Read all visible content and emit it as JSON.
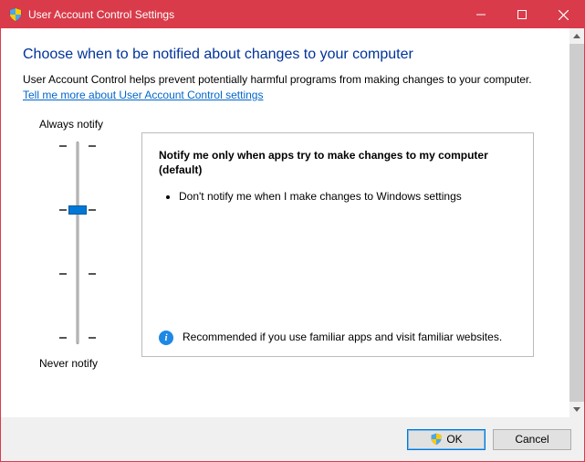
{
  "window": {
    "title": "User Account Control Settings"
  },
  "page": {
    "heading": "Choose when to be notified about changes to your computer",
    "description": "User Account Control helps prevent potentially harmful programs from making changes to your computer.",
    "help_link": "Tell me more about User Account Control settings"
  },
  "slider": {
    "top_label": "Always notify",
    "bottom_label": "Never notify",
    "levels": 4,
    "value_index": 1
  },
  "panel": {
    "heading": "Notify me only when apps try to make changes to my computer (default)",
    "bullet1": "Don't notify me when I make changes to Windows settings",
    "recommendation": "Recommended if you use familiar apps and visit familiar websites."
  },
  "buttons": {
    "ok": "OK",
    "cancel": "Cancel"
  }
}
